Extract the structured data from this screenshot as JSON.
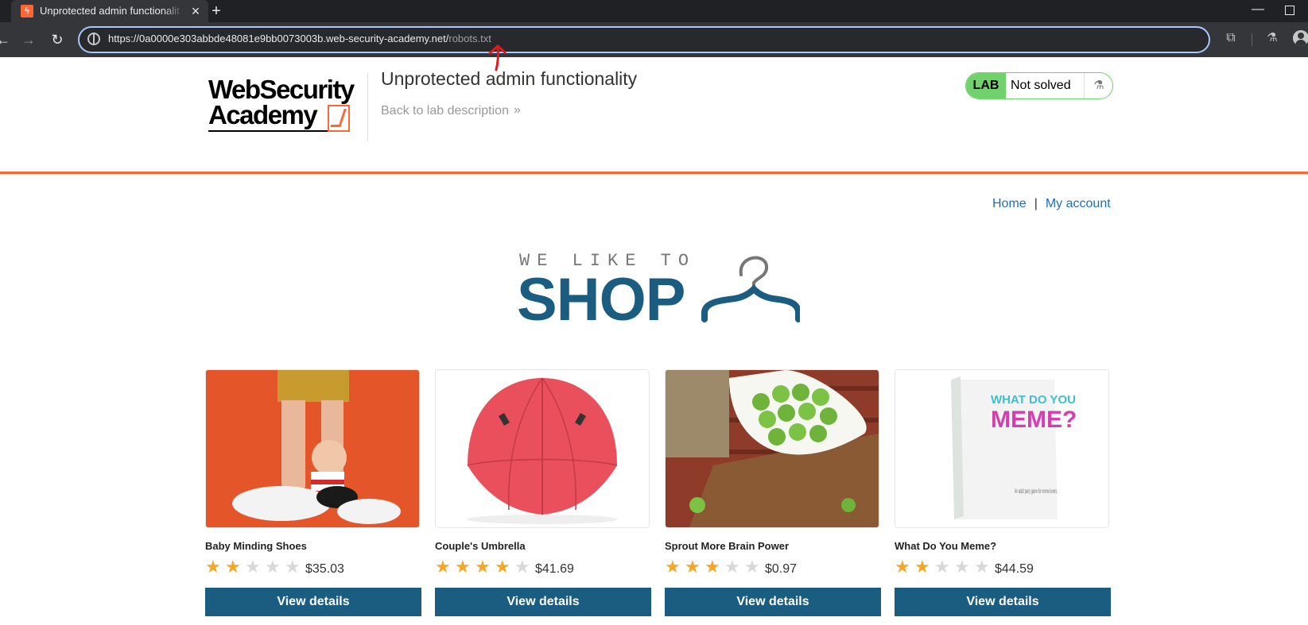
{
  "browser": {
    "tab_title": "Unprotected admin functionalit",
    "url_host": "https://0a0000e303abbde48081e9bb0073003b.web-security-academy.net/",
    "url_path": "robots.txt"
  },
  "lab": {
    "logo_line1": "WebSecurity",
    "logo_line2": "Academy",
    "title": "Unprotected admin functionality",
    "back_link": "Back to lab description",
    "back_chevrons": "»",
    "status_pill": "LAB",
    "status_text": "Not solved"
  },
  "nav": {
    "home": "Home",
    "separator": "|",
    "my_account": "My account"
  },
  "banner": {
    "small": "WE LIKE TO",
    "big": "SHOP"
  },
  "products": [
    {
      "name": "Baby Minding Shoes",
      "rating": 2,
      "price": "$35.03",
      "button": "View details"
    },
    {
      "name": "Couple's Umbrella",
      "rating": 4,
      "price": "$41.69",
      "button": "View details"
    },
    {
      "name": "Sprout More Brain Power",
      "rating": 3,
      "price": "$0.97",
      "button": "View details"
    },
    {
      "name": "What Do You Meme?",
      "rating": 2,
      "price": "$44.59",
      "button": "View details"
    }
  ],
  "product_images": {
    "meme_line1": "WHAT DO YOU",
    "meme_line2": "MEME?",
    "meme_tagline": "An adult party game for meme-lovers."
  },
  "colors": {
    "accent": "#ff6633",
    "primary": "#1a5d80",
    "link": "#1f6fb2",
    "lab_green": "#70d16d",
    "star": "#f5a623",
    "annotation": "#e01b1b"
  }
}
